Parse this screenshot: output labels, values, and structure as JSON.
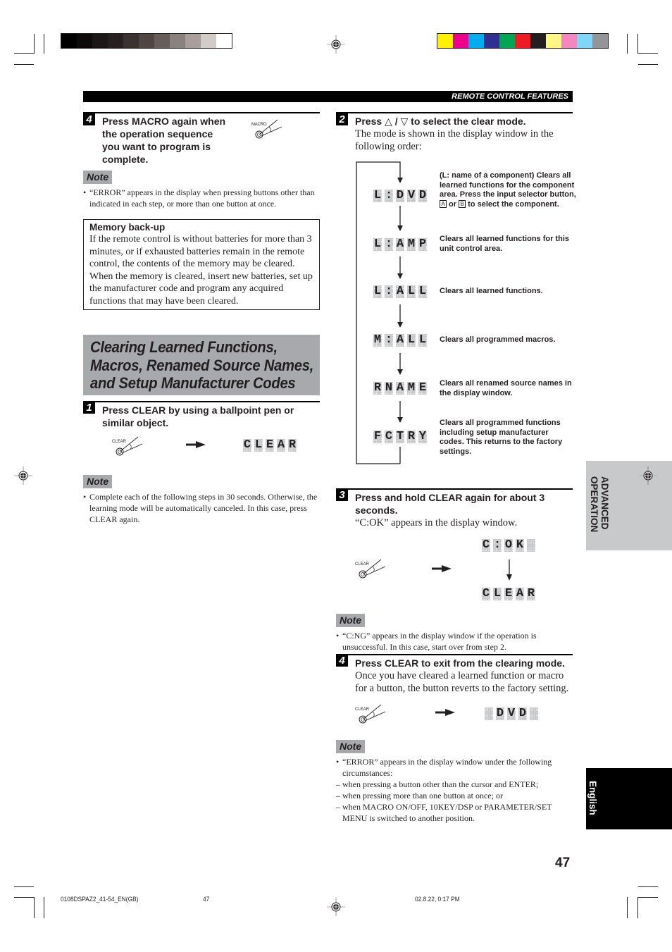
{
  "print_marks": {
    "grayscale_swatches": [
      "#000000",
      "#0d0b0a",
      "#1a1716",
      "#262120",
      "#3a3230",
      "#4f4643",
      "#665d5a",
      "#8a807c",
      "#a99e9b",
      "#d3cbc8",
      "#ffffff"
    ],
    "color_swatches": [
      "#fff200",
      "#ec008c",
      "#00aeef",
      "#2e3192",
      "#00a651",
      "#ed1c24",
      "#231f20",
      "#fff685",
      "#f587c0",
      "#7fd6f7",
      "#939598"
    ]
  },
  "header": {
    "section_label": "REMOTE CONTROL FEATURES"
  },
  "left_column": {
    "step4": {
      "number": "4",
      "title": "Press MACRO again when the operation sequence you want to program is complete.",
      "title_lines": [
        "Press MACRO again when",
        "the operation sequence",
        "you want to program is",
        "complete."
      ],
      "button_label": "MACRO"
    },
    "note1": {
      "label": "Note",
      "items": [
        "“ERROR” appears in the display when pressing buttons other than indicated in each step, or more than one button at once."
      ]
    },
    "memory_backup": {
      "title": "Memory back-up",
      "body": "If the remote control is without batteries for more than 3 minutes, or if exhausted batteries remain in the remote control, the contents of the memory may be cleared. When the memory is cleared, insert new batteries, set up the manufacturer code and program any acquired functions that may have been cleared."
    },
    "section_title_lines": [
      "Clearing Learned Functions,",
      "Macros, Renamed Source Names,",
      "and Setup Manufacturer Codes"
    ],
    "step1": {
      "number": "1",
      "title_lines": [
        "Press CLEAR by using a ballpoint pen or",
        "similar object."
      ],
      "button_label": "CLEAR",
      "display": [
        "C",
        "L",
        "E",
        "A",
        "R"
      ]
    },
    "note2": {
      "label": "Note",
      "items": [
        "Complete each of the following steps in 30 seconds. Otherwise, the learning mode will be automatically canceled. In this case, press CLEAR again."
      ]
    }
  },
  "right_column": {
    "step2": {
      "number": "2",
      "title_prefix": "Press ",
      "up_symbol": "△",
      "slash": " / ",
      "down_symbol": "▽",
      "title_suffix": " to select the clear mode.",
      "body": "The mode is shown in the display window in the following order:",
      "modes": [
        {
          "display": [
            "L",
            ":",
            "D",
            "V",
            "D"
          ],
          "description_parts": [
            "(L: name of a component) Clears all learned functions for the component area. Press the input selector button, ",
            "A",
            " or ",
            "B",
            " to select the component."
          ]
        },
        {
          "display": [
            "L",
            ":",
            "A",
            "M",
            "P"
          ],
          "description": "Clears all learned functions for this unit control area."
        },
        {
          "display": [
            "L",
            ":",
            "A",
            "L",
            "L"
          ],
          "description": "Clears all learned functions."
        },
        {
          "display": [
            "M",
            ":",
            "A",
            "L",
            "L"
          ],
          "description": "Clears all programmed macros."
        },
        {
          "display": [
            "R",
            "N",
            "A",
            "M",
            "E"
          ],
          "description": "Clears all renamed source names in the display window."
        },
        {
          "display": [
            "F",
            "C",
            "T",
            "R",
            "Y"
          ],
          "description": "Clears all programmed functions including setup manufacturer codes. This returns to the factory settings."
        }
      ]
    },
    "step3": {
      "number": "3",
      "title_lines": [
        "Press and hold CLEAR again for about 3",
        "seconds."
      ],
      "body": "“C:OK” appears in the display window.",
      "button_label": "CLEAR",
      "display_first": [
        "C",
        ":",
        "O",
        "K",
        " "
      ],
      "display_second": [
        "C",
        "L",
        "E",
        "A",
        "R"
      ]
    },
    "note3": {
      "label": "Note",
      "items": [
        "“C:NG” appears in the display window if the operation is unsuccessful. In this case, start over from step 2."
      ]
    },
    "step4": {
      "number": "4",
      "title": "Press CLEAR to exit from the clearing mode.",
      "body": "Once you have cleared a learned function or macro for a button, the button reverts to the factory setting.",
      "button_label": "CLEAR",
      "display": [
        " ",
        "D",
        "V",
        "D",
        " "
      ]
    },
    "note4": {
      "label": "Note",
      "bullet": "“ERROR” appears in the display window under the following circumstances:",
      "dashes": [
        "when pressing a button other than the cursor and ENTER;",
        "when pressing more than one button at once; or",
        "when MACRO ON/OFF, 10KEY/DSP or PARAMETER/SET MENU is switched to another position."
      ]
    }
  },
  "side_tabs": {
    "advanced_operation": [
      "ADVANCED",
      "OPERATION"
    ],
    "language": "English"
  },
  "page_number": "47",
  "footer": {
    "file": "0108DSPAZ2_41-54_EN(GB)",
    "page": "47",
    "timestamp": "02.8.22, 0:17 PM"
  }
}
